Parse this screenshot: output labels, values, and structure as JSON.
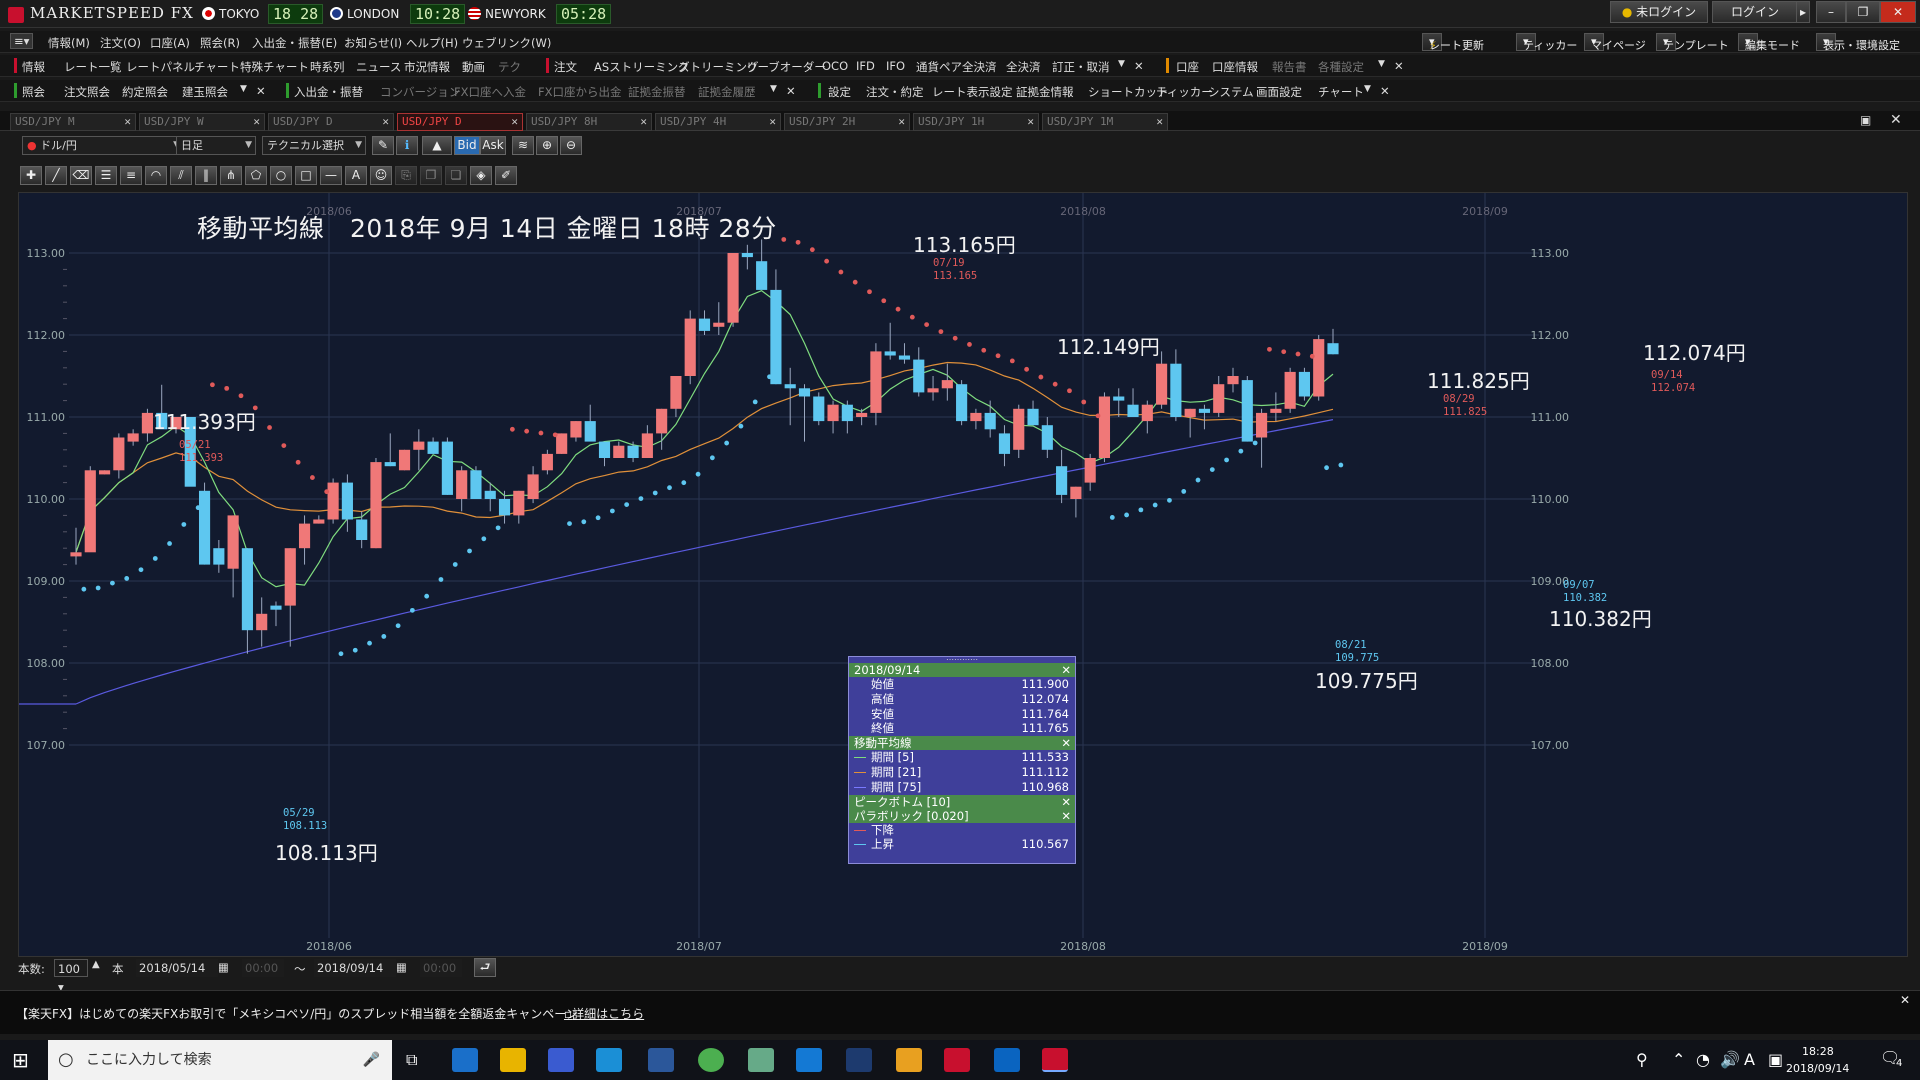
{
  "app": {
    "title": "MARKETSPEED FX"
  },
  "clocks": [
    {
      "city": "TOKYO",
      "time": "18 28"
    },
    {
      "city": "LONDON",
      "time": "10:28"
    },
    {
      "city": "NEWYORK",
      "time": "05:28"
    }
  ],
  "window_buttons": {
    "login_status": "未ログイン",
    "login": "ログイン"
  },
  "menu": [
    "情報(M)",
    "注文(O)",
    "口座(A)",
    "照会(R)",
    "入出金・振替(E)",
    "お知らせ(I)",
    "ヘルプ(H)",
    "ウェブリンク(W)"
  ],
  "right_buttons": [
    "レート更新",
    "ティッカー",
    "マイページ",
    "テンプレート",
    "編集モード",
    "表示・環境設定"
  ],
  "toolrow1": {
    "info_group": "情報",
    "info_items": [
      "レート一覧",
      "レートパネル",
      "チャート",
      "特殊チャート",
      "時系列",
      "ニュース",
      "市況情報",
      "動画",
      "テク"
    ],
    "order_group": "注文",
    "order_items": [
      "ASストリーミング",
      "ストリーミング",
      "リーブオーダー",
      "OCO",
      "IFD",
      "IFO",
      "通貨ペア全決済",
      "全決済",
      "訂正・取消"
    ],
    "account_group": "口座",
    "account_items": [
      "口座情報",
      "報告書",
      "各種設定"
    ]
  },
  "toolrow2": {
    "inquiry_group": "照会",
    "inquiry_items": [
      "注文照会",
      "約定照会",
      "建玉照会"
    ],
    "deposit_group": "入出金・振替",
    "deposit_items": [
      "コンバージョン",
      "FX口座へ入金",
      "FX口座から出金",
      "証拠金振替",
      "証拠金履歴"
    ],
    "settings_group": "設定",
    "settings_items": [
      "注文・約定",
      "レート表示設定",
      "証拠金情報",
      "ショートカット",
      "ティッカー",
      "システム",
      "画面設定",
      "チャート"
    ]
  },
  "tabs": [
    "USD/JPY M",
    "USD/JPY W",
    "USD/JPY D",
    "USD/JPY D",
    "USD/JPY 8H",
    "USD/JPY 4H",
    "USD/JPY 2H",
    "USD/JPY 1H",
    "USD/JPY 1M"
  ],
  "chart_toolbar": {
    "symbol": "ドル/円",
    "timeframe": "日足",
    "technical": "テクニカル選択",
    "bid": "Bid",
    "ask": "Ask"
  },
  "annotations": {
    "title": "移動平均線　2018年 9月 14日 金曜日 18時 28分",
    "labels": [
      "113.165円",
      "112.149円",
      "111.393円",
      "111.825円",
      "112.074円",
      "108.113円",
      "109.775円",
      "110.382円"
    ]
  },
  "peaks": [
    {
      "date": "07/19",
      "value": "113.165"
    },
    {
      "date": "05/21",
      "value": "111.393"
    },
    {
      "date": "08/29",
      "value": "111.825"
    },
    {
      "date": "09/14",
      "value": "112.074"
    },
    {
      "date": "05/29",
      "value": "108.113"
    },
    {
      "date": "08/21",
      "value": "109.775"
    },
    {
      "date": "09/07",
      "value": "110.382"
    }
  ],
  "tooltip": {
    "date": "2018/09/14",
    "ohlc": [
      {
        "label": "始値",
        "value": "111.900"
      },
      {
        "label": "高値",
        "value": "112.074"
      },
      {
        "label": "安値",
        "value": "111.764"
      },
      {
        "label": "終値",
        "value": "111.765"
      }
    ],
    "ma_header": "移動平均線",
    "ma": [
      {
        "label": "期間 [5]",
        "value": "111.533",
        "color": "#7fdc7f"
      },
      {
        "label": "期間 [21]",
        "value": "111.112",
        "color": "#e0903a"
      },
      {
        "label": "期間 [75]",
        "value": "110.968",
        "color": "#5a5ae0"
      }
    ],
    "pb_header": "ピークボトム [10]",
    "sar_header": "パラボリック [0.020]",
    "sar": [
      {
        "label": "下降",
        "value": "",
        "color": "#e05a5a"
      },
      {
        "label": "上昇",
        "value": "110.567",
        "color": "#5ec7f0"
      }
    ]
  },
  "bottombar": {
    "count_label": "本数:",
    "count": "100",
    "unit": "本",
    "from": "2018/05/14",
    "from_time": "00:00",
    "tilde": "〜",
    "to": "2018/09/14",
    "to_time": "00:00"
  },
  "news": "【楽天FX】はじめての楽天FXお取引で「メキシコペソ/円」のスプレッド相当額を全額返金キャンペーン",
  "news_link": "詳細はこちら",
  "taskbar": {
    "search": "ここに入力して検索",
    "time": "18:28",
    "date": "2018/09/14",
    "ime": "A",
    "notif": "4"
  },
  "colors": {
    "up": "#f07878",
    "down": "#5ec7f0",
    "ma5": "#7fdc7f",
    "ma21": "#e0903a",
    "ma75": "#5a5ae0",
    "sar_down": "#e05a5a",
    "sar_up": "#5ec7f0",
    "bg": "#121a2e"
  },
  "chart_data": {
    "type": "candlestick",
    "ylim": [
      107.0,
      113.0
    ],
    "yticks": [
      "113.00",
      "112.00",
      "111.00",
      "110.00",
      "109.00",
      "108.00",
      "107.00"
    ],
    "xticks": [
      "2018/06",
      "2018/07",
      "2018/08",
      "2018/09"
    ],
    "candles": [
      [
        109.3,
        109.65,
        109.2,
        109.35
      ],
      [
        109.35,
        110.4,
        109.4,
        110.35
      ],
      [
        110.3,
        110.35,
        110.3,
        110.35
      ],
      [
        110.35,
        110.8,
        110.25,
        110.75
      ],
      [
        110.7,
        110.85,
        110.65,
        110.8
      ],
      [
        110.8,
        111.1,
        110.7,
        111.05
      ],
      [
        111.05,
        111.393,
        110.9,
        110.85
      ],
      [
        110.85,
        111.0,
        110.8,
        111.0
      ],
      [
        111.0,
        111.0,
        110.2,
        110.15
      ],
      [
        110.1,
        110.2,
        109.2,
        109.2
      ],
      [
        109.4,
        109.5,
        109.1,
        109.2
      ],
      [
        109.15,
        109.8,
        108.8,
        109.8
      ],
      [
        109.4,
        109.4,
        108.113,
        108.4
      ],
      [
        108.4,
        108.8,
        108.2,
        108.6
      ],
      [
        108.7,
        108.75,
        108.45,
        108.65
      ],
      [
        108.7,
        109.4,
        108.2,
        109.4
      ],
      [
        109.4,
        109.8,
        109.2,
        109.7
      ],
      [
        109.7,
        109.8,
        109.7,
        109.75
      ],
      [
        109.75,
        110.25,
        109.7,
        110.2
      ],
      [
        110.2,
        110.3,
        109.6,
        109.75
      ],
      [
        109.75,
        109.85,
        109.4,
        109.5
      ],
      [
        109.4,
        110.5,
        109.4,
        110.45
      ],
      [
        110.45,
        110.8,
        110.4,
        110.4
      ],
      [
        110.35,
        110.6,
        110.35,
        110.6
      ],
      [
        110.6,
        110.85,
        110.35,
        110.7
      ],
      [
        110.7,
        110.75,
        110.55,
        110.55
      ],
      [
        110.7,
        110.75,
        110.05,
        110.05
      ],
      [
        110.0,
        110.4,
        109.85,
        110.35
      ],
      [
        110.35,
        110.4,
        110.0,
        110.0
      ],
      [
        110.1,
        110.2,
        109.85,
        110.0
      ],
      [
        110.0,
        110.1,
        109.7,
        109.8
      ],
      [
        109.8,
        110.1,
        109.7,
        110.1
      ],
      [
        110.0,
        110.4,
        109.95,
        110.3
      ],
      [
        110.35,
        110.6,
        110.3,
        110.55
      ],
      [
        110.55,
        110.8,
        110.55,
        110.8
      ],
      [
        110.75,
        110.95,
        110.7,
        110.95
      ],
      [
        110.95,
        111.15,
        110.85,
        110.7
      ],
      [
        110.7,
        110.7,
        110.4,
        110.5
      ],
      [
        110.5,
        110.7,
        110.5,
        110.65
      ],
      [
        110.65,
        110.7,
        110.45,
        110.5
      ],
      [
        110.5,
        110.9,
        110.5,
        110.8
      ],
      [
        110.8,
        111.1,
        110.6,
        111.1
      ],
      [
        111.1,
        111.5,
        111.0,
        111.5
      ],
      [
        111.5,
        112.3,
        111.4,
        112.2
      ],
      [
        112.2,
        112.3,
        112.0,
        112.05
      ],
      [
        112.1,
        112.4,
        112.0,
        112.15
      ],
      [
        112.15,
        113.0,
        112.1,
        113.0
      ],
      [
        113.0,
        113.1,
        112.8,
        112.95
      ],
      [
        112.9,
        113.165,
        112.6,
        112.55
      ],
      [
        112.55,
        112.8,
        111.4,
        111.4
      ],
      [
        111.4,
        111.6,
        110.9,
        111.35
      ],
      [
        111.35,
        111.4,
        110.7,
        111.25
      ],
      [
        111.25,
        111.3,
        110.9,
        110.95
      ],
      [
        110.95,
        111.2,
        110.8,
        111.15
      ],
      [
        111.15,
        111.2,
        110.8,
        110.95
      ],
      [
        111.0,
        111.1,
        110.9,
        111.05
      ],
      [
        111.05,
        111.9,
        110.9,
        111.8
      ],
      [
        111.8,
        112.149,
        111.7,
        111.75
      ],
      [
        111.75,
        111.9,
        111.65,
        111.7
      ],
      [
        111.7,
        111.85,
        111.25,
        111.3
      ],
      [
        111.3,
        111.5,
        111.2,
        111.35
      ],
      [
        111.35,
        111.65,
        111.2,
        111.45
      ],
      [
        111.4,
        111.45,
        110.9,
        110.95
      ],
      [
        110.95,
        111.1,
        110.85,
        111.05
      ],
      [
        111.05,
        111.2,
        110.75,
        110.85
      ],
      [
        110.8,
        110.9,
        110.4,
        110.55
      ],
      [
        110.6,
        111.15,
        110.5,
        111.1
      ],
      [
        111.1,
        111.2,
        110.9,
        110.9
      ],
      [
        110.9,
        111.0,
        110.5,
        110.6
      ],
      [
        110.4,
        110.6,
        109.95,
        110.05
      ],
      [
        110.0,
        110.15,
        109.775,
        110.15
      ],
      [
        110.2,
        110.55,
        110.1,
        110.5
      ],
      [
        110.5,
        111.3,
        110.45,
        111.25
      ],
      [
        111.25,
        111.35,
        111.0,
        111.2
      ],
      [
        111.15,
        111.35,
        111.0,
        111.0
      ],
      [
        110.95,
        111.2,
        110.8,
        111.15
      ],
      [
        111.15,
        111.8,
        111.1,
        111.65
      ],
      [
        111.65,
        111.825,
        110.95,
        111.0
      ],
      [
        111.0,
        111.1,
        110.75,
        111.1
      ],
      [
        111.1,
        111.15,
        110.85,
        111.05
      ],
      [
        111.05,
        111.5,
        111.0,
        111.4
      ],
      [
        111.4,
        111.6,
        111.3,
        111.5
      ],
      [
        111.45,
        111.5,
        110.7,
        110.7
      ],
      [
        110.75,
        111.1,
        110.382,
        111.05
      ],
      [
        111.05,
        111.3,
        110.95,
        111.1
      ],
      [
        111.1,
        111.6,
        111.05,
        111.55
      ],
      [
        111.55,
        111.6,
        111.2,
        111.25
      ],
      [
        111.25,
        112.0,
        111.2,
        111.95
      ],
      [
        111.9,
        112.074,
        111.764,
        111.765
      ]
    ]
  }
}
